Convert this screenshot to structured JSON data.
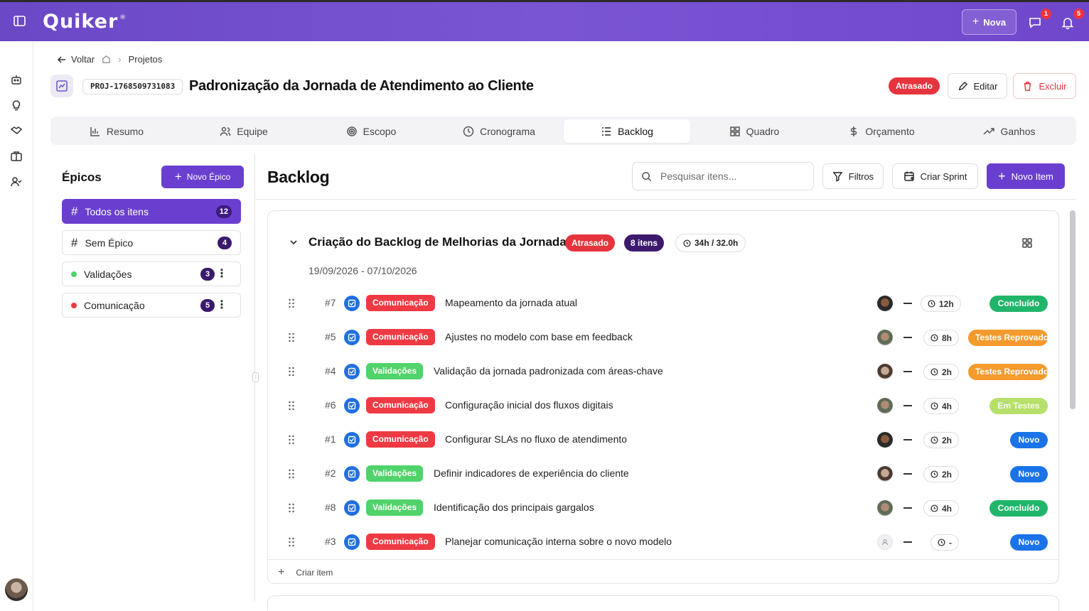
{
  "topbar": {
    "logo": "Quiker",
    "logo_mark": "®",
    "new_button": "Nova",
    "messages_badge": "1",
    "notifications_badge": "5"
  },
  "breadcrumb": {
    "back": "Voltar",
    "section": "Projetos"
  },
  "project": {
    "code": "PROJ-1768509731083",
    "title": "Padronização da Jornada de Atendimento ao Cliente",
    "status": "Atrasado",
    "edit_label": "Editar",
    "delete_label": "Excluir"
  },
  "tabs": [
    {
      "label": "Resumo",
      "icon": "bar-chart-icon"
    },
    {
      "label": "Equipe",
      "icon": "users-icon"
    },
    {
      "label": "Escopo",
      "icon": "target-icon"
    },
    {
      "label": "Cronograma",
      "icon": "clock-icon"
    },
    {
      "label": "Backlog",
      "icon": "list-icon"
    },
    {
      "label": "Quadro",
      "icon": "grid-icon"
    },
    {
      "label": "Orçamento",
      "icon": "dollar-icon"
    },
    {
      "label": "Ganhos",
      "icon": "trend-icon"
    }
  ],
  "epics": {
    "title": "Épicos",
    "new_button": "Novo Épico",
    "items": [
      {
        "label": "Todos os itens",
        "count": "12"
      },
      {
        "label": "Sem Épico",
        "count": "4"
      },
      {
        "label": "Validações",
        "count": "3",
        "color": "#4fd36a"
      },
      {
        "label": "Comunicação",
        "count": "5",
        "color": "#ef3a43"
      }
    ]
  },
  "backlog": {
    "title": "Backlog",
    "search_placeholder": "Pesquisar itens...",
    "filters_label": "Filtros",
    "create_sprint_label": "Criar Sprint",
    "new_item_label": "Novo Item"
  },
  "sprint": {
    "name": "Criação do Backlog de Melhorias da Jornada",
    "status": "Atrasado",
    "items_count": "8 itens",
    "hours": "34h / 32.0h",
    "dates": "19/09/2026 - 07/10/2026",
    "create_item": "Criar item",
    "items": [
      {
        "num": "#7",
        "epic": "Comunicação",
        "title": "Mapeamento da jornada atual",
        "time": "12h",
        "status": "Concluído"
      },
      {
        "num": "#5",
        "epic": "Comunicação",
        "title": "Ajustes no modelo com base em feedback",
        "time": "8h",
        "status": "Testes Reprovados"
      },
      {
        "num": "#4",
        "epic": "Validações",
        "title": "Validação da jornada padronizada com áreas-chave",
        "time": "2h",
        "status": "Testes Reprovados"
      },
      {
        "num": "#6",
        "epic": "Comunicação",
        "title": "Configuração inicial dos fluxos digitais",
        "time": "4h",
        "status": "Em Testes"
      },
      {
        "num": "#1",
        "epic": "Comunicação",
        "title": "Configurar SLAs no fluxo de atendimento",
        "time": "2h",
        "status": "Novo"
      },
      {
        "num": "#2",
        "epic": "Validações",
        "title": "Definir indicadores de experiência do cliente",
        "time": "2h",
        "status": "Novo"
      },
      {
        "num": "#8",
        "epic": "Validações",
        "title": "Identificação dos principais gargalos",
        "time": "4h",
        "status": "Concluído"
      },
      {
        "num": "#3",
        "epic": "Comunicação",
        "title": "Planejar comunicação interna sobre o novo modelo",
        "time": "-",
        "status": "Novo"
      }
    ]
  }
}
